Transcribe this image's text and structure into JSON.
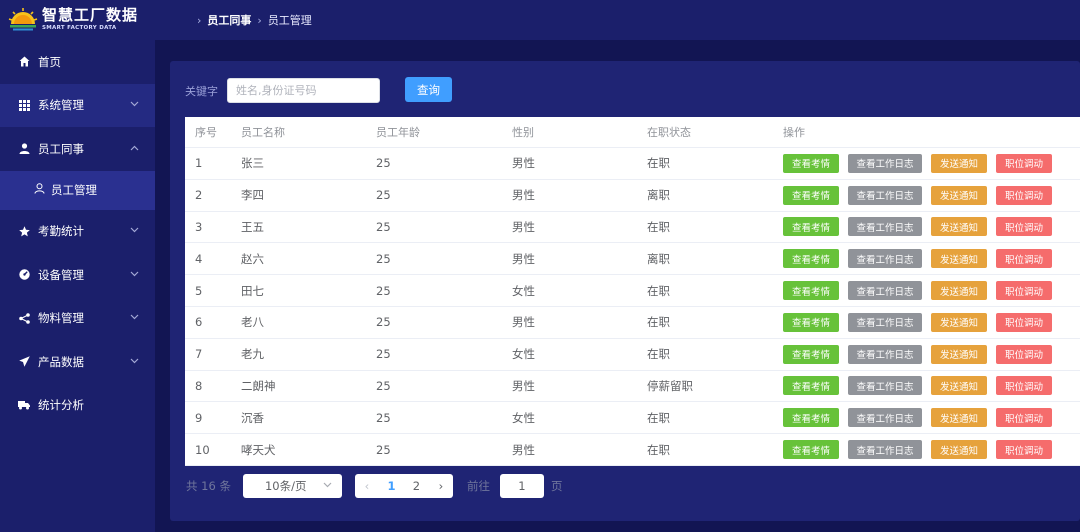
{
  "app": {
    "logo_cn": "智慧工厂数据",
    "logo_en": "SMART FACTORY DATA"
  },
  "breadcrumb": [
    "员工同事",
    "员工管理"
  ],
  "sidebar": {
    "items": [
      {
        "label": "首页",
        "icon": "home-icon"
      },
      {
        "label": "系统管理",
        "icon": "grid-icon"
      },
      {
        "label": "员工同事",
        "icon": "user-icon"
      },
      {
        "label": "员工管理",
        "icon": "person-icon"
      },
      {
        "label": "考勤统计",
        "icon": "star-icon"
      },
      {
        "label": "设备管理",
        "icon": "dashboard-icon"
      },
      {
        "label": "物料管理",
        "icon": "share-icon"
      },
      {
        "label": "产品数据",
        "icon": "send-icon"
      },
      {
        "label": "统计分析",
        "icon": "truck-icon"
      }
    ]
  },
  "search": {
    "label": "关键字",
    "placeholder": "姓名,身份证号码",
    "button": "查询"
  },
  "table": {
    "headers": [
      "序号",
      "员工名称",
      "员工年龄",
      "性别",
      "在职状态",
      "操作"
    ],
    "actions": [
      "查看考情",
      "查看工作日志",
      "发送通知",
      "职位调动"
    ],
    "rows": [
      {
        "no": "1",
        "name": "张三",
        "age": "25",
        "gender": "男性",
        "status": "在职"
      },
      {
        "no": "2",
        "name": "李四",
        "age": "25",
        "gender": "男性",
        "status": "离职"
      },
      {
        "no": "3",
        "name": "王五",
        "age": "25",
        "gender": "男性",
        "status": "在职"
      },
      {
        "no": "4",
        "name": "赵六",
        "age": "25",
        "gender": "男性",
        "status": "离职"
      },
      {
        "no": "5",
        "name": "田七",
        "age": "25",
        "gender": "女性",
        "status": "在职"
      },
      {
        "no": "6",
        "name": "老八",
        "age": "25",
        "gender": "男性",
        "status": "在职"
      },
      {
        "no": "7",
        "name": "老九",
        "age": "25",
        "gender": "女性",
        "status": "在职"
      },
      {
        "no": "8",
        "name": "二朗神",
        "age": "25",
        "gender": "男性",
        "status": "停薪留职"
      },
      {
        "no": "9",
        "name": "沉香",
        "age": "25",
        "gender": "女性",
        "status": "在职"
      },
      {
        "no": "10",
        "name": "哮天犬",
        "age": "25",
        "gender": "男性",
        "status": "在职"
      }
    ]
  },
  "pagination": {
    "total": "共 16 条",
    "page_size": "10条/页",
    "pages": [
      "1",
      "2"
    ],
    "current_page": "1",
    "goto_label": "前往",
    "goto_value": "1",
    "page_unit": "页"
  },
  "colors": {
    "primary": "#409eff",
    "success": "#67c23a",
    "info": "#909399",
    "warning": "#e6a23c",
    "danger": "#f56c6c"
  }
}
